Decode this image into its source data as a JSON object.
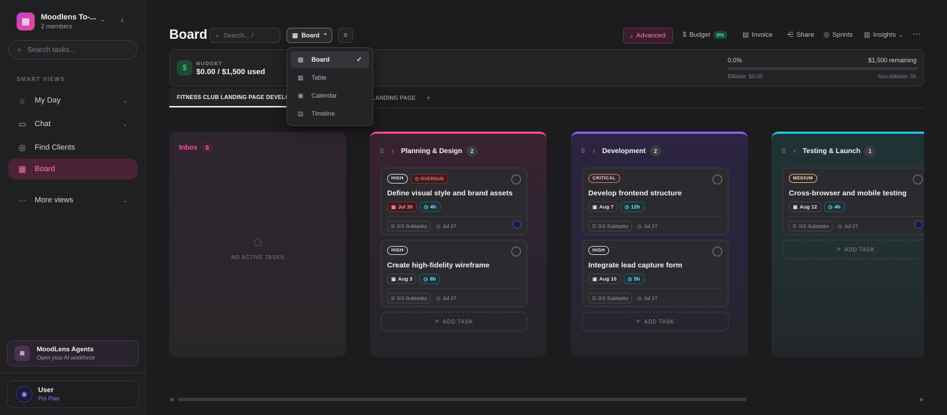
{
  "workspace": {
    "name": "Moodlens To-...",
    "members": "2 members",
    "logo_icon": "building-icon"
  },
  "sidebar": {
    "search_placeholder": "Search tasks...",
    "section_label": "SMART VIEWS",
    "items": [
      {
        "label": "My Day",
        "icon": "sun-icon"
      },
      {
        "label": "Chat",
        "icon": "chat-icon"
      },
      {
        "label": "Find Clients",
        "icon": "target-icon"
      },
      {
        "label": "Board",
        "icon": "board-icon",
        "active": true
      },
      {
        "label": "More views",
        "icon": "dots-icon"
      }
    ],
    "agents": {
      "title": "MoodLens Agents",
      "subtitle": "Open your AI workforce"
    },
    "user": {
      "name": "User",
      "plan": "Pro Plan"
    }
  },
  "header": {
    "title": "Board",
    "search_placeholder": "Search... /",
    "view_label": "Board",
    "toolbar": {
      "advanced": "Advanced",
      "budget": "Budget",
      "budget_pct": "0%",
      "invoice": "Invoice",
      "share": "Share",
      "sprints": "Sprints",
      "insights": "Insights"
    }
  },
  "budget": {
    "label": "BUDGET",
    "value": "$0.00 / $1,500 used",
    "percent_text": "0.0%",
    "remaining": "$1,500 remaining",
    "billable": "Billable: $0.00",
    "non_billable": "Non-billable: 0h",
    "progress_fraction": 0
  },
  "tabs": [
    {
      "label": "FITNESS CLUB LANDING PAGE DEVELOP",
      "active": true
    },
    {
      "label": "LANDING PAGE",
      "active": false
    }
  ],
  "view_menu": {
    "items": [
      {
        "label": "Board",
        "icon": "board-icon",
        "selected": true
      },
      {
        "label": "Table",
        "icon": "table-icon"
      },
      {
        "label": "Calendar",
        "icon": "calendar-icon"
      },
      {
        "label": "Timeline",
        "icon": "timeline-icon"
      }
    ]
  },
  "columns": {
    "inbox": {
      "name": "Inbox",
      "count": "0",
      "empty_text": "NO ACTIVE TASKS",
      "accent": "#ff4f9a"
    },
    "planning": {
      "name": "Planning & Design",
      "count": "2",
      "accent": "#ff4f9a",
      "cards": [
        {
          "priority": "HIGH",
          "overdue": "OVERDUE",
          "title": "Define visual style and brand assets",
          "date": "Jul 30",
          "estimate": "4h",
          "subtasks": "0/3 Subtasks",
          "due": "Jul 27"
        },
        {
          "priority": "HIGH",
          "title": "Create high-fidelity wireframe",
          "date": "Aug 3",
          "estimate": "8h",
          "subtasks": "0/3 Subtasks",
          "due": "Jul 27"
        }
      ],
      "add_label": "ADD TASK"
    },
    "development": {
      "name": "Development",
      "count": "2",
      "accent": "#9a5cff",
      "cards": [
        {
          "priority": "CRITICAL",
          "title": "Develop frontend structure",
          "date": "Aug 7",
          "estimate": "12h",
          "subtasks": "0/3 Subtasks",
          "due": "Jul 27"
        },
        {
          "priority": "HIGH",
          "title": "Integrate lead capture form",
          "date": "Aug 10",
          "estimate": "5h",
          "subtasks": "0/3 Subtasks",
          "due": "Jul 27"
        }
      ],
      "add_label": "ADD TASK"
    },
    "testing": {
      "name": "Testing & Launch",
      "count": "1",
      "accent": "#22c8e0",
      "cards": [
        {
          "priority": "MEDIUM",
          "title": "Cross-browser and mobile testing",
          "date": "Aug 12",
          "estimate": "4h",
          "subtasks": "0/3 Subtasks",
          "due": "Jul 27"
        }
      ],
      "add_label": "ADD TASK"
    }
  }
}
